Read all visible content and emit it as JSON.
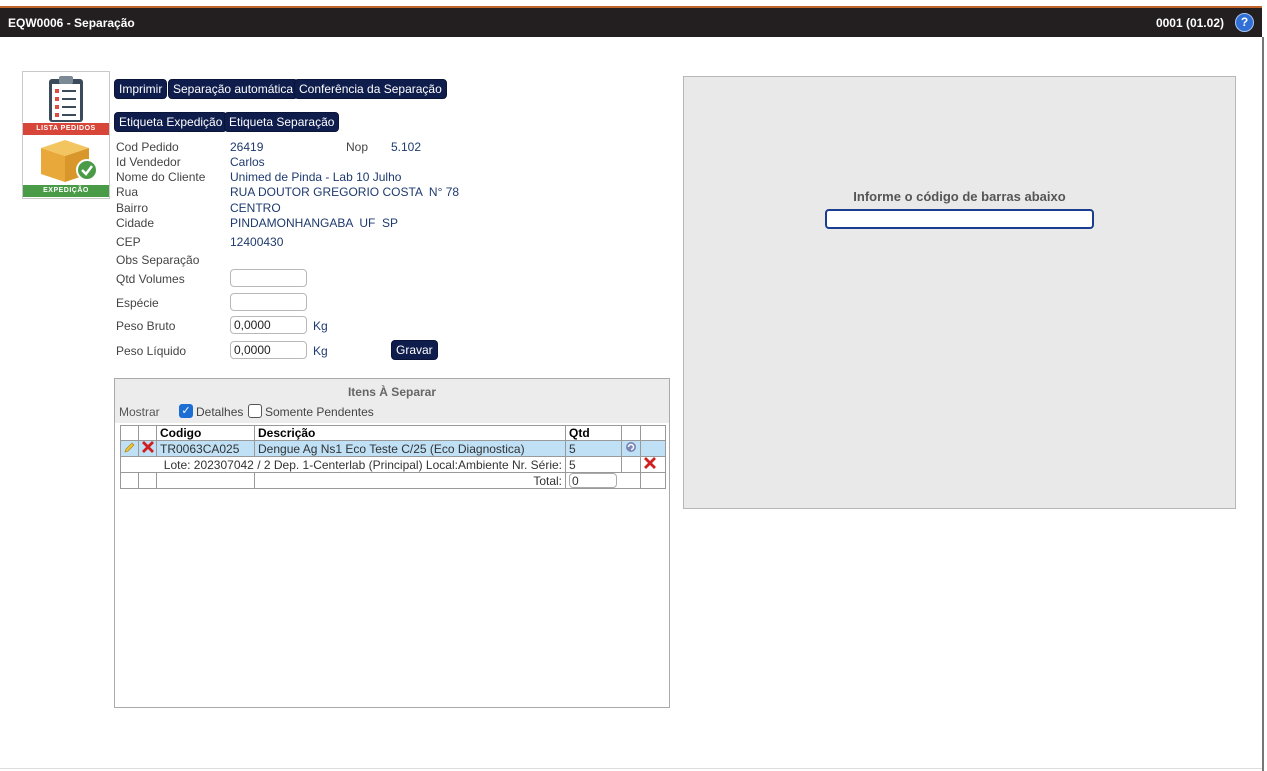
{
  "window": {
    "title": "EQW0006 - Separação",
    "version": "0001 (01.02)",
    "help": "?"
  },
  "logo": {
    "top_label": "LISTA PEDIDOS",
    "bottom_label": "EXPEDIÇÃO"
  },
  "toolbar": {
    "imprimir": "Imprimir",
    "separacao_automatica": "Separação automática",
    "conferencia": "Conferência da Separação",
    "etiqueta_expedicao": "Etiqueta Expedição",
    "etiqueta_separacao": "Etiqueta Separação"
  },
  "order": {
    "cod_pedido_label": "Cod Pedido",
    "cod_pedido": "26419",
    "nop_label": "Nop",
    "nop": "5.102",
    "vendedor_label": "Id Vendedor",
    "vendedor": "Carlos",
    "cliente_label": "Nome do Cliente",
    "cliente": "Unimed de Pinda - Lab 10 Julho",
    "rua_label": "Rua",
    "rua": "RUA DOUTOR GREGORIO COSTA  N° 78",
    "bairro_label": "Bairro",
    "bairro": "CENTRO",
    "cidade_label": "Cidade",
    "cidade": "PINDAMONHANGABA  UF  SP",
    "cep_label": "CEP",
    "cep": "12400430",
    "obs_label": "Obs Separação"
  },
  "form": {
    "qtd_volumes_label": "Qtd Volumes",
    "qtd_volumes": "",
    "especie_label": "Espécie",
    "especie": "",
    "peso_bruto_label": "Peso Bruto",
    "peso_bruto": "0,0000",
    "peso_liquido_label": "Peso Líquido",
    "peso_liquido": "0,0000",
    "unit": "Kg",
    "gravar": "Gravar"
  },
  "items": {
    "title": "Itens À Separar",
    "mostrar": "Mostrar",
    "detalhes": "Detalhes",
    "detalhes_checked": true,
    "pendentes": "Somente Pendentes",
    "pendentes_checked": false,
    "headers": {
      "codigo": "Codigo",
      "descricao": "Descrição",
      "qtd": "Qtd"
    },
    "row": {
      "codigo": "TR0063CA025",
      "descricao": "Dengue Ag Ns1 Eco Teste C/25 (Eco Diagnostica)",
      "qtd": "5"
    },
    "detail": {
      "text": "Lote: 202307042 / 2 Dep. 1-Centerlab (Principal) Local:Ambiente Nr. Série:",
      "qtd": "5"
    },
    "total_label": "Total:",
    "total": "0"
  },
  "barcode": {
    "label": "Informe o código de barras abaixo",
    "value": ""
  }
}
